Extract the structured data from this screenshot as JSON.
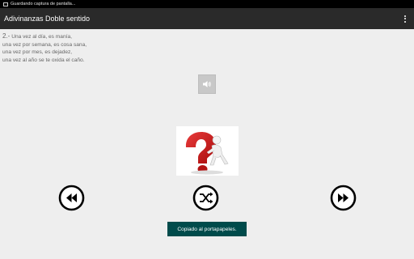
{
  "status_bar": {
    "notification": "Guardando captura de pantalla..."
  },
  "app_bar": {
    "title": "Adivinanzas Doble sentido",
    "overflow_icon": "more-vert-icon"
  },
  "riddle": {
    "number": "2.-",
    "lines": [
      "Una vez al día, es manía,",
      "una vez por semana, es cosa sana,",
      "una vez por mes, es dejadez,",
      "una vez al año se te oxida el caño."
    ]
  },
  "controls": {
    "speaker_icon": "speaker-icon",
    "prev_icon": "rewind-icon",
    "shuffle_icon": "shuffle-icon",
    "next_icon": "fast-forward-icon"
  },
  "toast": {
    "text": "Copiado al portapapeles."
  },
  "colors": {
    "background": "#eeeeee",
    "app_bar": "#2a2a2a",
    "toast": "#004b4b",
    "accent_red": "#cc1a1a"
  }
}
